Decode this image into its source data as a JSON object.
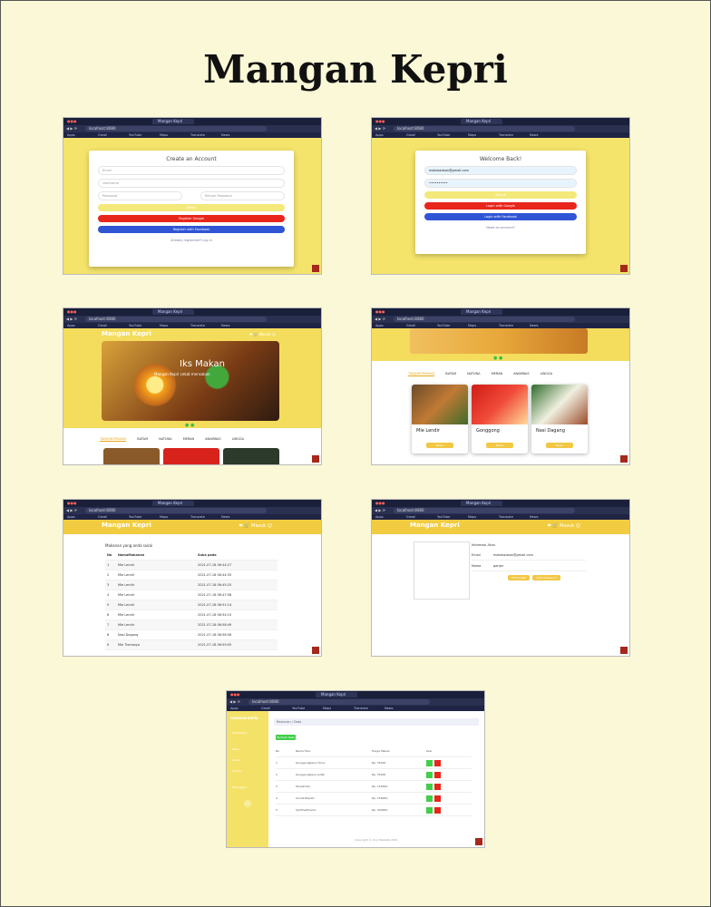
{
  "title": "Mangan Kepri",
  "browser": {
    "tab": "Mangan Kepri",
    "url": "localhost:8080",
    "bookmarks": [
      "Apps",
      "Gmail",
      "YouTube",
      "Maps",
      "Translate",
      "News"
    ]
  },
  "register": {
    "heading": "Create an Account",
    "fields": [
      "Email",
      "Username",
      "Password",
      "Retype Password"
    ],
    "submit": "Daftar",
    "google": "Register Google",
    "facebook": "Register with Facebook",
    "login_link": "Already registered? Log in"
  },
  "login": {
    "heading": "Welcome Back!",
    "email": "mabmadaan@gmail.com",
    "password": "••••••••••",
    "submit": "Masuk",
    "google": "Login with Google",
    "facebook": "Login with Facebook",
    "register_link": "Need an account?"
  },
  "home": {
    "brand": "Mangan Kepri",
    "hero_title": "Iks Makan",
    "hero_sub": "Mangan Kepri cekat mensakan",
    "nav_icons": [
      "❤",
      "🛒",
      "Masuk",
      "☺"
    ],
    "categories": [
      "TANJUNGPINANG",
      "BATAM",
      "NATUNA",
      "MERAN",
      "ANAMBAS",
      "LINGGA"
    ]
  },
  "menu": {
    "items": [
      "Mie Lendir",
      "Gonggong",
      "Nasi Dagang"
    ],
    "button": "Pesan"
  },
  "orders": {
    "caption": "Makanan yang anda sukai",
    "headers": [
      "No",
      "NamaMakanan",
      "Suka pada"
    ],
    "rows": [
      [
        "1",
        "Mie Lendir",
        "2021-07-18 06:44:27"
      ],
      [
        "2",
        "Mie Lendir",
        "2021-07-18 06:44:35"
      ],
      [
        "3",
        "Mie Lendir",
        "2021-07-18 06:45:25"
      ],
      [
        "4",
        "Mie Lendir",
        "2021-07-18 06:47:58"
      ],
      [
        "5",
        "Mie Lendir",
        "2021-07-18 06:51:14"
      ],
      [
        "6",
        "Mie Lendir",
        "2021-07-18 06:54:15"
      ],
      [
        "7",
        "Mie Lendir",
        "2021-07-18 06:58:49"
      ],
      [
        "8",
        "Nasi Dagang",
        "2021-07-18 06:58:56"
      ],
      [
        "9",
        "Mie Tiomasya",
        "2021-07-18 06:59:05"
      ]
    ]
  },
  "profile": {
    "heading": "Informasi Akun",
    "email_label": "Email",
    "email": "mabmadaan@gmail.com",
    "name_label": "Nama",
    "name": "ganjar",
    "btn_edit": "Edit profile",
    "btn_pass": "Ganti Password"
  },
  "admin": {
    "logo": "MANGAN KEPRI",
    "sidebar": [
      "Dashboard",
      "Menu",
      "Users",
      "Orders",
      "Pelanggan"
    ],
    "breadcrumb": "Restoran / Data",
    "add_button": "Tambah Data",
    "headers": [
      "No",
      "Nama Toko",
      "Harga Makan",
      "Aksi"
    ],
    "rows": [
      [
        "1",
        "Gonggongbena Timur",
        "Rp. 35000"
      ],
      [
        "2",
        "Gonggongbena jodah",
        "Rp. 35000"
      ],
      [
        "3",
        "Tanjakman",
        "Rp. 150000"
      ],
      [
        "4",
        "Sunda Bawah",
        "Rp. 150000"
      ],
      [
        "5",
        "Spicthaithanho",
        "Rp. 290000"
      ]
    ],
    "footer": "Copyright © Your Website 2021"
  }
}
